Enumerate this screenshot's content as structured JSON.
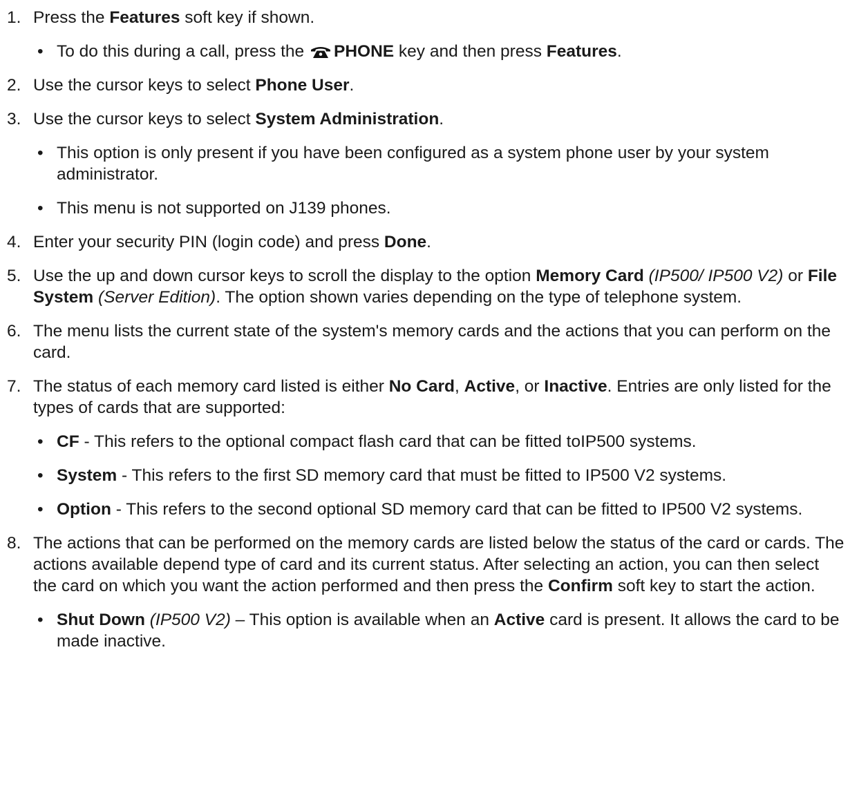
{
  "steps": [
    {
      "num": "1.",
      "t": [
        "Press the ",
        "Features",
        " soft key if shown."
      ],
      "subs": [
        {
          "t": [
            "To do this during a call, press the ",
            "PHONE",
            " key and then press ",
            "Features",
            "."
          ],
          "icon": "phone-icon"
        }
      ]
    },
    {
      "num": "2.",
      "t": [
        "Use the cursor keys to select ",
        "Phone User",
        "."
      ]
    },
    {
      "num": "3.",
      "t": [
        "Use the cursor keys to select ",
        "System Administration",
        "."
      ],
      "subs": [
        {
          "t": [
            "This option is only present if you have been configured as a system phone user by your system administrator."
          ]
        },
        {
          "t": [
            "This menu is not supported on J139 phones."
          ]
        }
      ]
    },
    {
      "num": "4.",
      "t": [
        "Enter your security PIN (login code) and press ",
        "Done",
        "."
      ]
    },
    {
      "num": "5.",
      "t": [
        "Use the up and down cursor keys to scroll the display to the option ",
        "Memory Card",
        " ",
        "(IP500/ IP500 V2)",
        " or ",
        "File System",
        " ",
        "(Server Edition)",
        ". The option shown varies depending on the type of telephone system."
      ]
    },
    {
      "num": "6.",
      "t": [
        "The menu lists the current state of the system's memory cards and the actions that you can perform on the card."
      ]
    },
    {
      "num": "7.",
      "t": [
        "The status of each memory card listed is either ",
        "No Card",
        ", ",
        "Active",
        ", or ",
        "Inactive",
        ". Entries are only listed for the types of cards that are supported:"
      ],
      "subs": [
        {
          "t": [
            "CF",
            " - This refers to the optional compact flash card that can be fitted toIP500 systems."
          ]
        },
        {
          "t": [
            "System",
            " - This refers to the first SD memory card that must be fitted to IP500 V2 systems."
          ]
        },
        {
          "t": [
            "Option",
            " - This refers to the second optional SD memory card that can be fitted to IP500 V2 systems."
          ]
        }
      ]
    },
    {
      "num": "8.",
      "t": [
        "The actions that can be performed on the memory cards are listed below the status of the card or cards. The actions available depend type of card and its current status. After selecting an action, you can then select the card on which you want the action performed and then press the ",
        "Confirm",
        " soft key to start the action."
      ],
      "subs": [
        {
          "t": [
            "Shut Down",
            " ",
            "(IP500 V2)",
            " – This option is available when an ",
            "Active",
            " card is present. It allows the card to be made inactive."
          ]
        }
      ]
    }
  ],
  "bullet_char": "•"
}
